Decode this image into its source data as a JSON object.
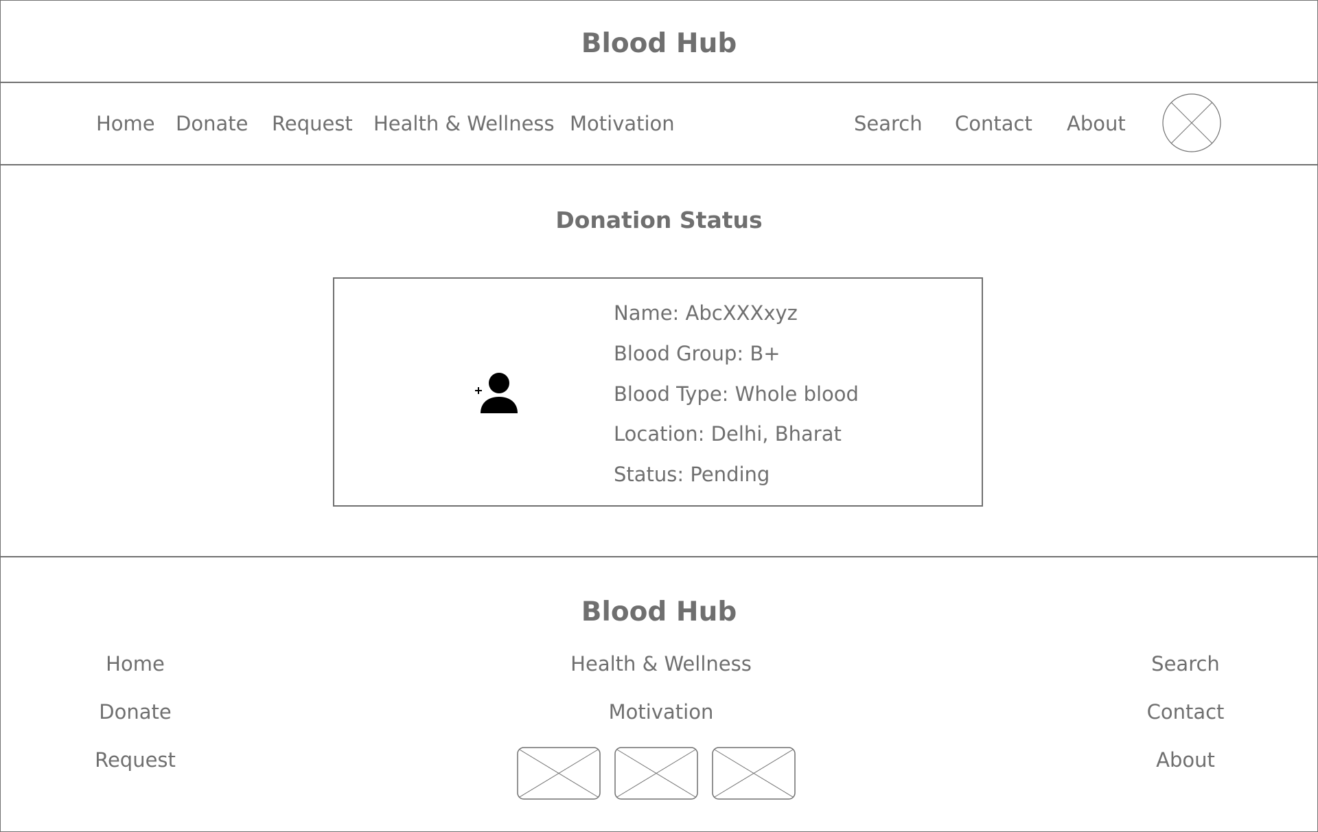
{
  "header": {
    "brand": "Blood Hub"
  },
  "nav": {
    "left": [
      "Home",
      "Donate",
      "Request",
      "Health & Wellness",
      "Motivation"
    ],
    "right": [
      "Search",
      "Contact",
      "About"
    ],
    "avatar_icon": "image-placeholder-icon"
  },
  "main": {
    "title": "Donation Status",
    "card": {
      "icon": "add-person-icon",
      "lines": [
        "Name: AbcXXXxyz",
        "Blood Group: B+",
        "Blood Type: Whole blood",
        "Location: Delhi, Bharat",
        "Status: Pending"
      ]
    }
  },
  "footer": {
    "brand": "Blood Hub",
    "col_left": [
      "Home",
      "Donate",
      "Request"
    ],
    "col_center": [
      "Health & Wellness",
      "Motivation"
    ],
    "col_right": [
      "Search",
      "Contact",
      "About"
    ],
    "social_icons": [
      "image-placeholder-icon",
      "image-placeholder-icon",
      "image-placeholder-icon"
    ]
  },
  "colors": {
    "line": "#6f6f6f",
    "text": "#6f6f6f",
    "icon": "#000000"
  }
}
